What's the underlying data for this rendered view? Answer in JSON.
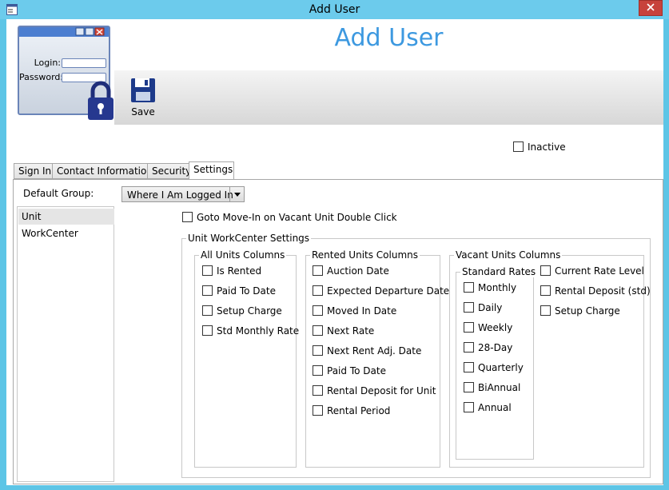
{
  "window": {
    "title": "Add User"
  },
  "header": {
    "title": "Add User"
  },
  "logo": {
    "login_label": "Login:",
    "password_label": "Password:"
  },
  "toolbar": {
    "save_label": "Save"
  },
  "inactive": {
    "label": "Inactive",
    "checked": false
  },
  "tabs": [
    {
      "label": "Sign In",
      "active": false
    },
    {
      "label": "Contact Information",
      "active": false
    },
    {
      "label": "Security",
      "active": false
    },
    {
      "label": "Settings",
      "active": true
    }
  ],
  "settings": {
    "default_group_label": "Default Group:",
    "default_group_value": "Where I Am Logged In",
    "list_items": [
      {
        "label": "Unit",
        "selected": true
      },
      {
        "label": "WorkCenter",
        "selected": false
      }
    ],
    "goto_move_in_label": "Goto Move-In on Vacant Unit Double Click",
    "unit_workcenter_title": "Unit WorkCenter Settings",
    "all_units": {
      "title": "All Units Columns",
      "items": [
        "Is Rented",
        "Paid To Date",
        "Setup Charge",
        "Std Monthly Rate"
      ]
    },
    "rented_units": {
      "title": "Rented Units Columns",
      "items": [
        "Auction Date",
        "Expected Departure Date",
        "Moved In Date",
        "Next Rate",
        "Next Rent Adj. Date",
        "Paid To Date",
        "Rental Deposit for Unit",
        "Rental Period"
      ]
    },
    "vacant_units": {
      "title": "Vacant Units Columns",
      "standard_rates_title": "Standard Rates",
      "standard_rates": [
        "Monthly",
        "Daily",
        "Weekly",
        "28-Day",
        "Quarterly",
        "BiAnnual",
        "Annual"
      ],
      "other_items": [
        "Current Rate Level",
        "Rental Deposit (std)",
        "Setup Charge"
      ]
    }
  },
  "colors": {
    "title_bar": "#6ccbec",
    "header_title": "#3d99e0",
    "close_button": "#c7423b"
  }
}
